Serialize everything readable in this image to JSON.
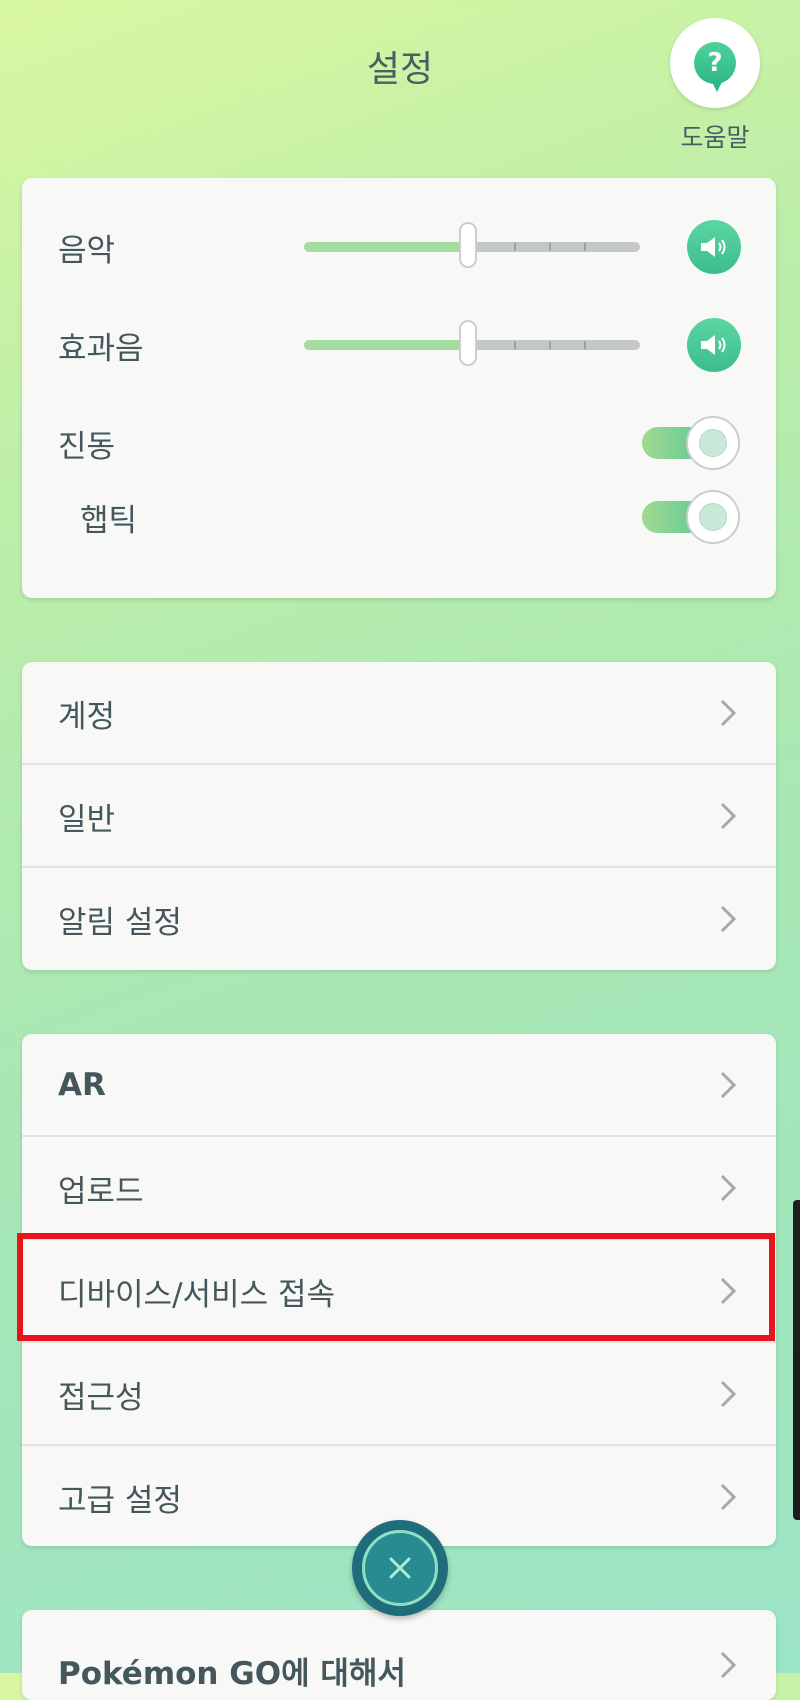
{
  "header": {
    "title": "설정",
    "help_label": "도움말"
  },
  "audio": {
    "music_label": "음악",
    "music_level": 0.49,
    "sfx_label": "효과음",
    "sfx_level": 0.49,
    "vibration_label": "진동",
    "vibration_on": true,
    "haptic_label": "햅틱",
    "haptic_on": true
  },
  "section2": {
    "items": [
      "계정",
      "일반",
      "알림 설정"
    ]
  },
  "section3": {
    "items": [
      "AR",
      "업로드",
      "디바이스/서비스 접속",
      "접근성",
      "고급 설정"
    ]
  },
  "section4": {
    "about_label": "Pokémon GO에 대해서"
  },
  "colors": {
    "accent_green": "#4cc59a",
    "close_teal": "#1f6c7c",
    "highlight_red": "#e8141b"
  },
  "icons": {
    "help": "question-bubble-icon",
    "speaker": "speaker-icon",
    "chevron": "chevron-right-icon",
    "close": "close-icon"
  }
}
